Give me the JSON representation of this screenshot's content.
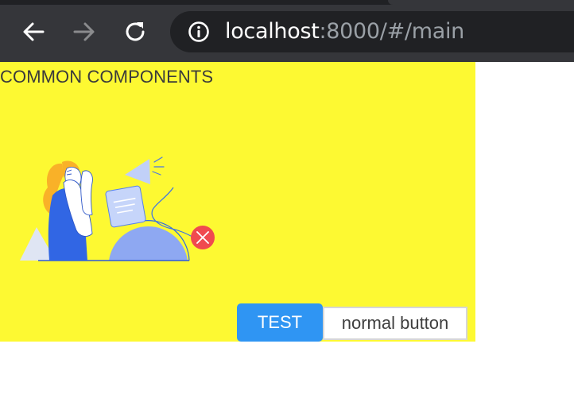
{
  "browser": {
    "url_host": "localhost",
    "url_rest": ":8000/#/main",
    "icons": {
      "back": "arrow-left-icon",
      "forward": "arrow-right-icon",
      "reload": "reload-icon",
      "site_info": "info-icon"
    },
    "colors": {
      "bar": "#35363a",
      "omnibox": "#202124"
    }
  },
  "page": {
    "title": "COMMON COMPONENTS",
    "background": "#fdf932",
    "illustration": "woman-megaphone-error-illustration"
  },
  "buttons": {
    "primary_label": "TEST",
    "normal_label": "normal button",
    "primary_color": "#2f95f3"
  }
}
